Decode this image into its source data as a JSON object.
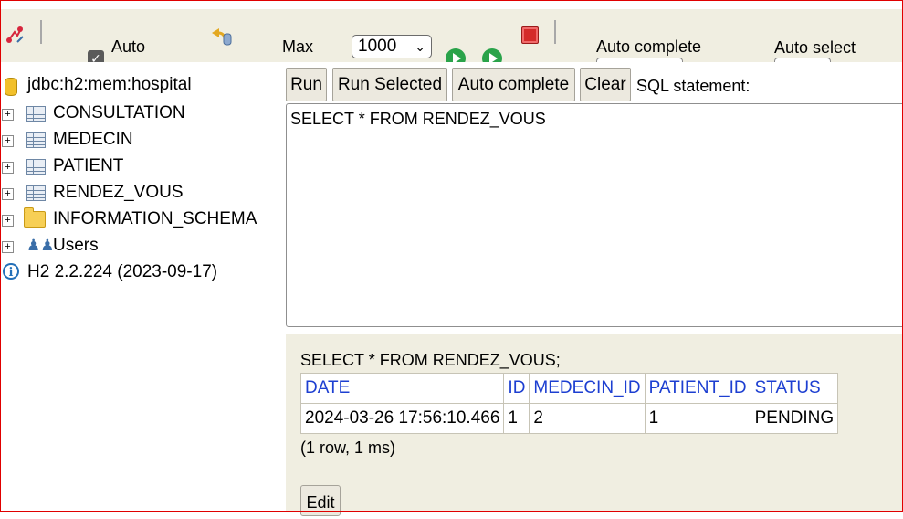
{
  "toolbar": {
    "auto_label": "Auto",
    "max_label": "Max",
    "max_value": "1000",
    "auto_complete_label": "Auto complete",
    "auto_select_label": "Auto select",
    "checkbox_checked": true
  },
  "tree": {
    "connection": "jdbc:h2:mem:hospital",
    "items": [
      {
        "label": "CONSULTATION",
        "icon": "table-icon"
      },
      {
        "label": "MEDECIN",
        "icon": "table-icon"
      },
      {
        "label": "PATIENT",
        "icon": "table-icon"
      },
      {
        "label": "RENDEZ_VOUS",
        "icon": "table-icon"
      },
      {
        "label": "INFORMATION_SCHEMA",
        "icon": "folder-icon"
      },
      {
        "label": "Users",
        "icon": "users-icon"
      }
    ],
    "version": "H2 2.2.224 (2023-09-17)"
  },
  "query": {
    "buttons": {
      "run": "Run",
      "run_selected": "Run Selected",
      "auto_complete": "Auto complete",
      "clear": "Clear"
    },
    "sql_label": "SQL statement:",
    "sql_text": "SELECT * FROM RENDEZ_VOUS"
  },
  "result": {
    "query": "SELECT * FROM RENDEZ_VOUS;",
    "columns": [
      "DATE",
      "ID",
      "MEDECIN_ID",
      "PATIENT_ID",
      "STATUS"
    ],
    "rows": [
      [
        "2024-03-26 17:56:10.466",
        "1",
        "2",
        "1",
        "PENDING"
      ]
    ],
    "summary": "(1 row, 1 ms)",
    "edit_label": "Edit"
  },
  "colors": {
    "toolbar_bg": "#f0eee1",
    "header_link": "#1d3fd1",
    "frame": "#e00000"
  }
}
